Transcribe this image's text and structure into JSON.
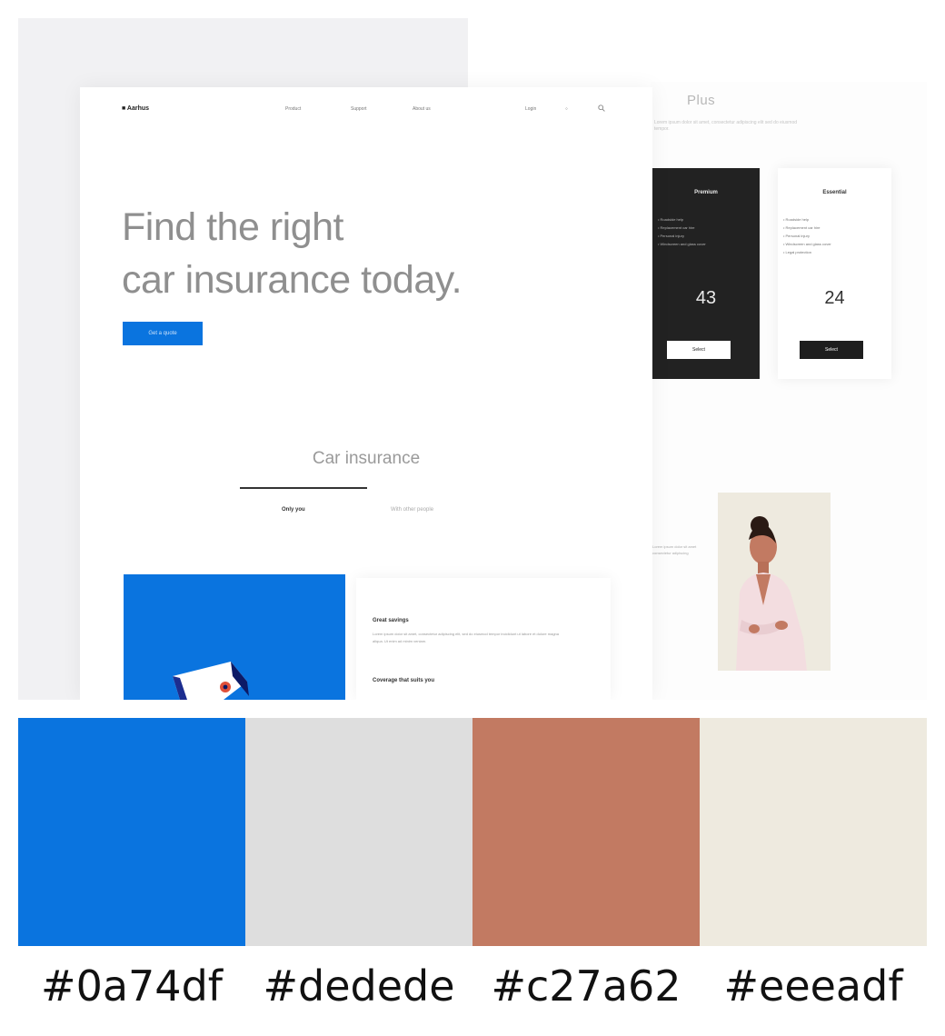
{
  "mockup": {
    "nav": {
      "logo": "■ Aarhus",
      "links": [
        "Product",
        "Support",
        "About us"
      ],
      "login_label": "Login",
      "lang_icon": "globe-icon",
      "search_icon": "search-icon"
    },
    "hero": {
      "title_line1": "Find the right",
      "title_line2": "car insurance today.",
      "cta_label": "Get a quote"
    },
    "section": {
      "title": "Car insurance",
      "tabs": [
        "Only you",
        "With other people"
      ]
    },
    "features": [
      {
        "title": "Great savings",
        "body": "Lorem ipsum dolor sit amet, consectetur adipiscing elit, sed do eiusmod tempor incididunt ut labore et dolore magna aliqua. Ut enim ad minim veniam."
      },
      {
        "title": "Coverage that suits you",
        "body": ""
      }
    ],
    "pricing": {
      "heading": "Plus",
      "subtext": "Lorem ipsum dolor sit amet, consectetur adipiscing elit sed do eiusmod tempor.",
      "plans": [
        {
          "name": "Premium",
          "features": [
            "Roadside help",
            "Replacement car hire",
            "Personal injury",
            "Windscreen and glass cover"
          ],
          "price": "43",
          "button": "Select"
        },
        {
          "name": "Essential",
          "features": [
            "Roadside help",
            "Replacement car hire",
            "Personal injury",
            "Windscreen and glass cover",
            "Legal protection"
          ],
          "price": "24",
          "button": "Select"
        }
      ]
    },
    "testimonial": {
      "text": "Lorem ipsum dolor sit amet consectetur adipiscing"
    }
  },
  "palette": [
    {
      "hex": "#0a74df",
      "label": "#0a74df"
    },
    {
      "hex": "#dedede",
      "label": "#dedede"
    },
    {
      "hex": "#c27a62",
      "label": "#c27a62"
    },
    {
      "hex": "#eeeadf",
      "label": "#eeeadf"
    }
  ]
}
